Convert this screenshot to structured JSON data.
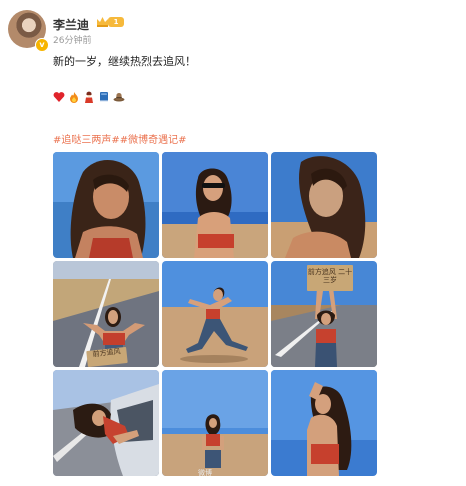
{
  "post": {
    "author": "李兰迪",
    "time_ago": "26分钟前",
    "text": "新的一岁，继续热烈去追风！",
    "level_badge": "1",
    "hashtags": "#追哒三两声##微博奇遇记#",
    "emojis": [
      "heart-icon",
      "fire-icon",
      "person-icon",
      "book-icon",
      "hat-icon"
    ]
  },
  "photos": [
    {
      "name": "photo-1",
      "scene": "closeup-tan"
    },
    {
      "name": "photo-2",
      "scene": "sunglasses-desert"
    },
    {
      "name": "photo-3",
      "scene": "closeup-tan"
    },
    {
      "name": "photo-4",
      "scene": "road-sign"
    },
    {
      "name": "photo-5",
      "scene": "jumping"
    },
    {
      "name": "photo-6",
      "scene": "holding-sign"
    },
    {
      "name": "photo-7",
      "scene": "car-window"
    },
    {
      "name": "photo-8",
      "scene": "standing-far"
    },
    {
      "name": "photo-9",
      "scene": "hair-sky"
    }
  ],
  "signs": {
    "road": "前方追风",
    "hold": "前方追风 二十三岁"
  },
  "watermark": "微博"
}
